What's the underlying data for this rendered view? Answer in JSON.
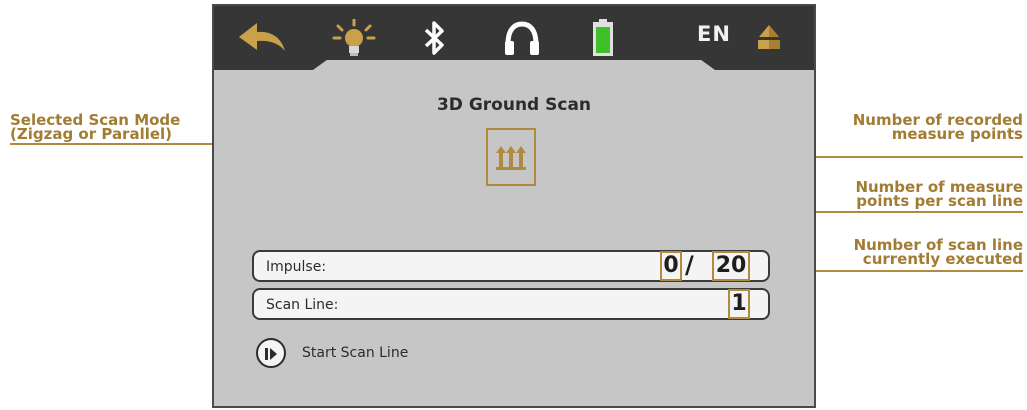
{
  "topbar": {
    "icons": [
      "back-arrow-icon",
      "lightbulb-icon",
      "bluetooth-icon",
      "headphones-icon",
      "battery-icon",
      "language",
      "sensor-icon"
    ],
    "language_label": "EN"
  },
  "screen": {
    "title": "3D Ground Scan",
    "scan_mode_icon": "parallel-arrows-icon",
    "impulse": {
      "label": "Impulse:",
      "recorded": "0",
      "separator": "/",
      "per_line": "20"
    },
    "scan_line": {
      "label": "Scan Line:",
      "value": "1"
    },
    "start_label": "Start Scan Line"
  },
  "annotations": {
    "scan_mode": [
      "Selected Scan Mode",
      "(Zigzag or Parallel)"
    ],
    "recorded": [
      "Number of recorded",
      "measure points"
    ],
    "per_line": [
      "Number of measure",
      "points per scan line"
    ],
    "current_line": [
      "Number of scan line",
      "currently executed"
    ]
  },
  "colors": {
    "topbar": "#363636",
    "screen": "#c6c6c6",
    "accent_gold": "#b08a3e",
    "battery_green": "#3fbf2a"
  }
}
